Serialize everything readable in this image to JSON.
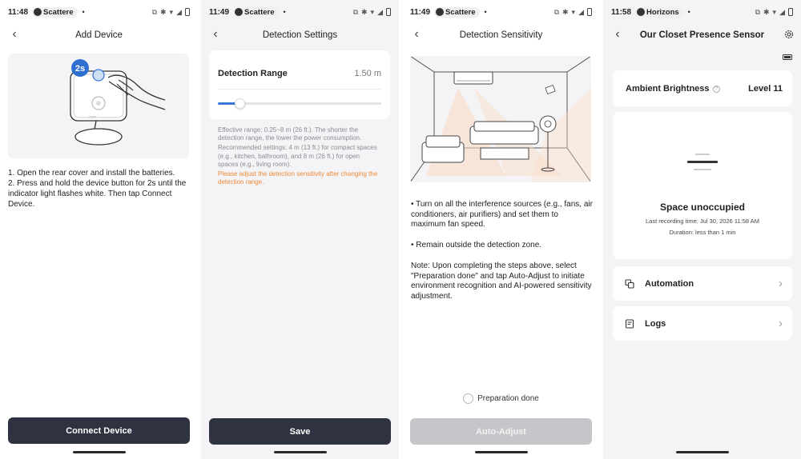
{
  "screens": [
    {
      "status": {
        "time": "11:48",
        "app": "Scattere",
        "bullet": "•"
      },
      "title": "Add Device",
      "illustration": {
        "badge": "2s"
      },
      "instructions": [
        "1. Open the rear cover and install the batteries.",
        "2. Press and hold the device button for 2s until the indicator light flashes white. Then tap Connect Device."
      ],
      "button": "Connect Device"
    },
    {
      "status": {
        "time": "11:49",
        "app": "Scattere",
        "bullet": "•"
      },
      "title": "Detection Settings",
      "range_label": "Detection Range",
      "range_value": "1.50 m",
      "slider_fraction": 0.13,
      "note1": "Effective range: 0.25~8 m (26 ft.). The shorter the detection range, the lower the power consumption.",
      "note2": "Recommended settings: 4 m (13 ft.) for compact spaces (e.g., kitchen, bathroom), and 8 m (26 ft.) for open spaces (e.g., living room).",
      "warning": "Please adjust the detection sensitivity after changing the detection range.",
      "button": "Save"
    },
    {
      "status": {
        "time": "11:49",
        "app": "Scattere",
        "bullet": "•"
      },
      "title": "Detection Sensitivity",
      "p1": "• Turn on all the interference sources (e.g., fans, air conditioners, air purifiers) and set them to maximum fan speed.",
      "p2": "• Remain outside the detection zone.",
      "p3": "Note: Upon completing the steps above, select \"Preparation done\" and tap Auto-Adjust to initiate environment recognition and AI-powered sensitivity adjustment.",
      "prep_label": "Preparation done",
      "button": "Auto-Adjust"
    },
    {
      "status": {
        "time": "11:58",
        "app": "Horizons",
        "bullet": "•"
      },
      "title": "Our Closet Presence Sensor",
      "brightness_label": "Ambient Brightness",
      "brightness_value": "Level 11",
      "state": "Space unoccupied",
      "last_recording": "Last recording time: Jul 30, 2026 11:58 AM",
      "duration": "Duration: less than 1 min",
      "automation": "Automation",
      "logs": "Logs"
    }
  ],
  "colors": {
    "button": "#2f3341",
    "slider": "#3a78d8",
    "warning": "#ef8a3a"
  }
}
